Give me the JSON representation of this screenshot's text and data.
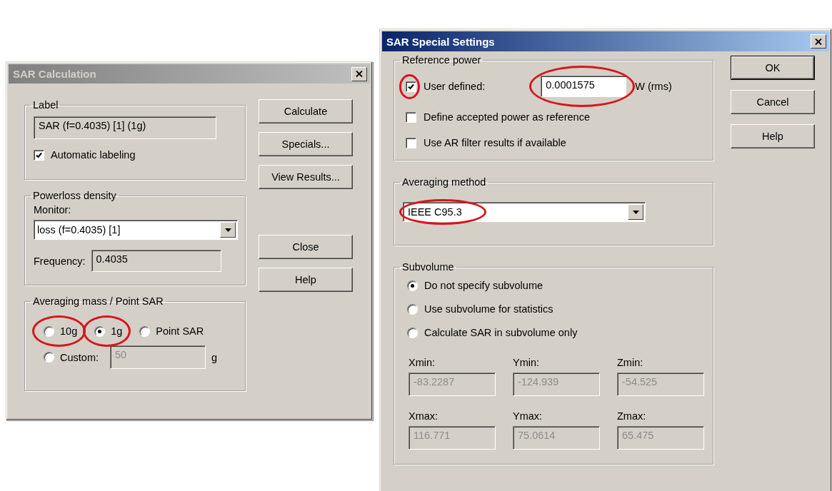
{
  "calc_dialog": {
    "title": "SAR Calculation",
    "active": false,
    "label_group": {
      "title": "Label",
      "value": "SAR (f=0.4035) [1] (1g)",
      "auto_label": {
        "label": "Automatic labeling",
        "checked": true
      }
    },
    "powerloss_group": {
      "title": "Powerloss density",
      "monitor_label": "Monitor:",
      "monitor": "loss (f=0.4035) [1]",
      "frequency_label": "Frequency:",
      "frequency": "0.4035"
    },
    "mass_group": {
      "title": "Averaging mass / Point SAR",
      "options": [
        {
          "label": "10g",
          "selected": false,
          "highlighted": true
        },
        {
          "label": "1g",
          "selected": true,
          "highlighted": true
        },
        {
          "label": "Point SAR",
          "selected": false,
          "highlighted": false
        },
        {
          "label": "Custom:",
          "selected": false,
          "highlighted": false
        }
      ],
      "custom_value": "50",
      "custom_disabled": true,
      "custom_unit": "g"
    },
    "action_buttons": [
      "Calculate",
      "Specials...",
      "View Results..."
    ],
    "dialog_buttons": [
      "Close",
      "Help"
    ]
  },
  "special_dialog": {
    "title": "SAR Special Settings",
    "active": true,
    "reference_group": {
      "title": "Reference power",
      "options": [
        {
          "label": "User defined:",
          "checked": true,
          "highlighted": true,
          "value": "0.0001575",
          "value_highlighted": true,
          "unit": "W (rms)"
        },
        {
          "label": "Define accepted power as reference",
          "checked": false,
          "highlighted": false
        },
        {
          "label": "Use AR filter results if available",
          "checked": false,
          "highlighted": false
        }
      ]
    },
    "averaging_group": {
      "title": "Averaging method",
      "value": "IEEE C95.3",
      "highlighted": true
    },
    "subvolume_group": {
      "title": "Subvolume",
      "options": [
        {
          "label": "Do not specify subvolume",
          "selected": true
        },
        {
          "label": "Use subvolume for statistics",
          "selected": false
        },
        {
          "label": "Calculate SAR in subvolume only",
          "selected": false
        }
      ],
      "fields": [
        {
          "label": "Xmin:",
          "value": "-83.2287",
          "disabled": true
        },
        {
          "label": "Ymin:",
          "value": "-124.939",
          "disabled": true
        },
        {
          "label": "Zmin:",
          "value": "-54.525",
          "disabled": true
        },
        {
          "label": "Xmax:",
          "value": "116.771",
          "disabled": true
        },
        {
          "label": "Ymax:",
          "value": "75.0614",
          "disabled": true
        },
        {
          "label": "Zmax:",
          "value": "65.475",
          "disabled": true
        }
      ]
    },
    "buttons": [
      {
        "label": "OK",
        "default": true
      },
      {
        "label": "Cancel",
        "default": false
      },
      {
        "label": "Help",
        "default": false
      }
    ]
  }
}
